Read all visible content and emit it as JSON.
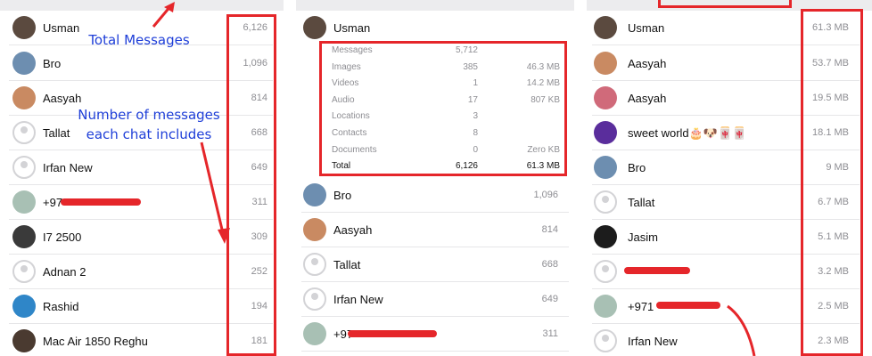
{
  "panel1": {
    "rows": [
      {
        "name": "Usman",
        "count": "6,126"
      },
      {
        "name": "Bro",
        "count": "1,096"
      },
      {
        "name": "Aasyah",
        "count": "814"
      },
      {
        "name": "Tallat",
        "count": "668"
      },
      {
        "name": "Irfan New",
        "count": "649"
      },
      {
        "name": "+97",
        "count": "311"
      },
      {
        "name": "I7 2500",
        "count": "309"
      },
      {
        "name": "Adnan 2",
        "count": "252"
      },
      {
        "name": "Rashid",
        "count": "194"
      },
      {
        "name": "Mac Air 1850 Reghu",
        "count": "181"
      }
    ],
    "annotations": {
      "total_messages": "Total Messages",
      "number_of_messages": "Number of messages each chat includes"
    }
  },
  "panel2": {
    "header_name": "Usman",
    "details": [
      {
        "label": "Messages",
        "count": "5,712",
        "size": ""
      },
      {
        "label": "Images",
        "count": "385",
        "size": "46.3 MB"
      },
      {
        "label": "Videos",
        "count": "1",
        "size": "14.2 MB"
      },
      {
        "label": "Audio",
        "count": "17",
        "size": "807 KB"
      },
      {
        "label": "Locations",
        "count": "3",
        "size": ""
      },
      {
        "label": "Contacts",
        "count": "8",
        "size": ""
      },
      {
        "label": "Documents",
        "count": "0",
        "size": "Zero KB"
      }
    ],
    "total": {
      "label": "Total",
      "count": "6,126",
      "size": "61.3 MB"
    },
    "rows": [
      {
        "name": "Bro",
        "count": "1,096"
      },
      {
        "name": "Aasyah",
        "count": "814"
      },
      {
        "name": "Tallat",
        "count": "668"
      },
      {
        "name": "Irfan New",
        "count": "649"
      },
      {
        "name": "+97",
        "count": "311"
      }
    ]
  },
  "panel3": {
    "rows": [
      {
        "name": "Usman",
        "size": "61.3 MB"
      },
      {
        "name": "Aasyah",
        "size": "53.7 MB"
      },
      {
        "name": "Aasyah",
        "size": "19.5 MB"
      },
      {
        "name": "sweet world🎂🐶🀄🀄",
        "size": "18.1 MB"
      },
      {
        "name": "Bro",
        "size": "9 MB"
      },
      {
        "name": "Tallat",
        "size": "6.7 MB"
      },
      {
        "name": "Jasim",
        "size": "5.1 MB"
      },
      {
        "name": "",
        "size": "3.2 MB"
      },
      {
        "name": "+971",
        "size": "2.5 MB"
      },
      {
        "name": "Irfan New",
        "size": "2.3 MB"
      }
    ]
  },
  "colors": {
    "annotation_red": "#e5262a",
    "annotation_blue": "#1f3fd8",
    "separator": "#e6e6e8",
    "secondary_text": "#8e8e93"
  }
}
